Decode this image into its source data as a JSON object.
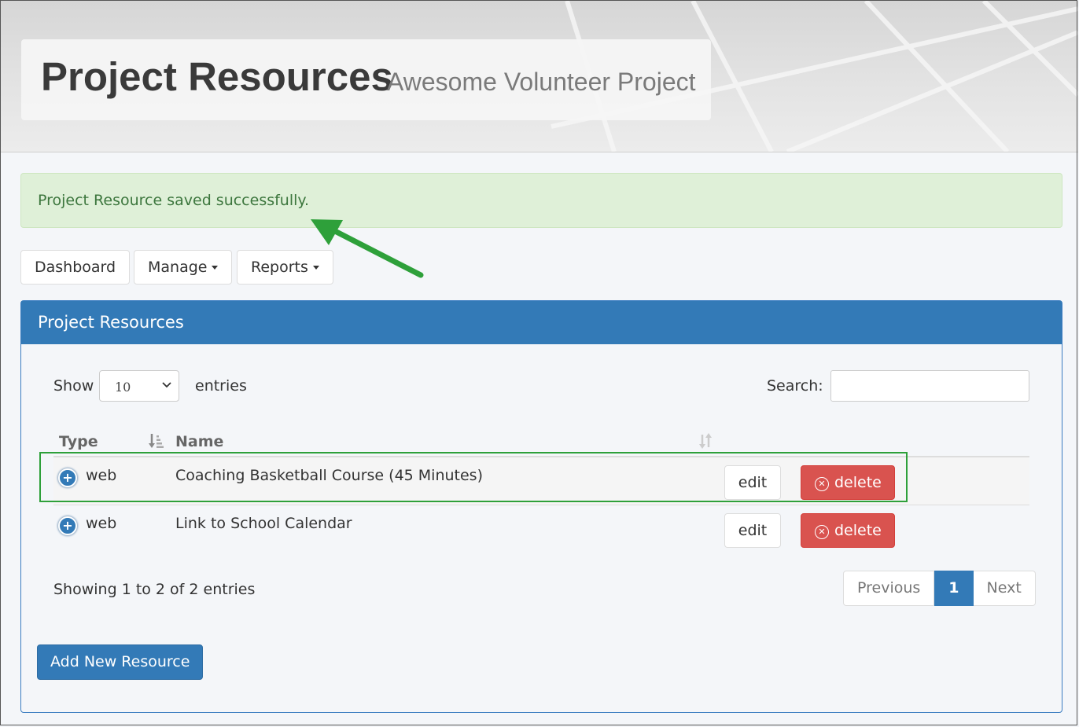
{
  "header": {
    "title": "Project Resources",
    "subtitle": "Awesome Volunteer Project"
  },
  "alert": {
    "message": "Project Resource saved successfully."
  },
  "nav": {
    "dashboard": "Dashboard",
    "manage": "Manage",
    "reports": "Reports"
  },
  "panel": {
    "title": "Project Resources",
    "length_menu": {
      "show_label": "Show",
      "selected": "10",
      "entries_label": "entries"
    },
    "search_label": "Search:",
    "columns": [
      "Type",
      "Name"
    ],
    "rows": [
      {
        "type": "web",
        "name": "Coaching Basketball Course (45 Minutes)",
        "edit": "edit",
        "delete": "delete"
      },
      {
        "type": "web",
        "name": "Link to School Calendar",
        "edit": "edit",
        "delete": "delete"
      }
    ],
    "info": "Showing 1 to 2 of 2 entries",
    "pagination": {
      "previous": "Previous",
      "current": "1",
      "next": "Next"
    },
    "add_button": "Add New Resource"
  },
  "colors": {
    "primary": "#337ab7",
    "danger": "#d9534f",
    "success_bg": "#dff0d8",
    "success_text": "#3c763d",
    "annotation": "#2ea03a"
  }
}
